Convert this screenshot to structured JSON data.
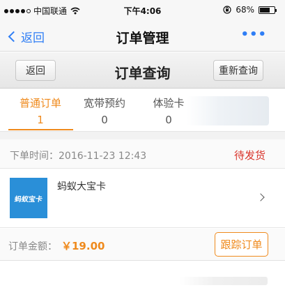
{
  "status_bar": {
    "carrier": "中国联通",
    "time": "下午4:06",
    "battery_percent": "68%",
    "battery_level": 0.68
  },
  "nav": {
    "back_label": "返回",
    "title": "订单管理",
    "more_label": "•••"
  },
  "sub_header": {
    "back_label": "返回",
    "title": "订单查询",
    "requery_label": "重新查询"
  },
  "tabs": [
    {
      "label": "普通订单",
      "count": "1",
      "active": true
    },
    {
      "label": "宽带预约",
      "count": "0",
      "active": false
    },
    {
      "label": "体验卡",
      "count": "0",
      "active": false
    }
  ],
  "order": {
    "time_label": "下单时间：2016-11-23   12:43",
    "status": "待发货",
    "product_name": "蚂蚁大宝卡",
    "thumb_text": "蚂蚁宝卡",
    "amount_label": "订单金额：",
    "amount_value": "￥19.00",
    "track_label": "跟踪订单"
  },
  "colors": {
    "accent_orange": "#ef8a1d",
    "link_blue": "#2f7ef5",
    "status_red": "#d9342b",
    "thumb_blue": "#2a8fd8"
  }
}
